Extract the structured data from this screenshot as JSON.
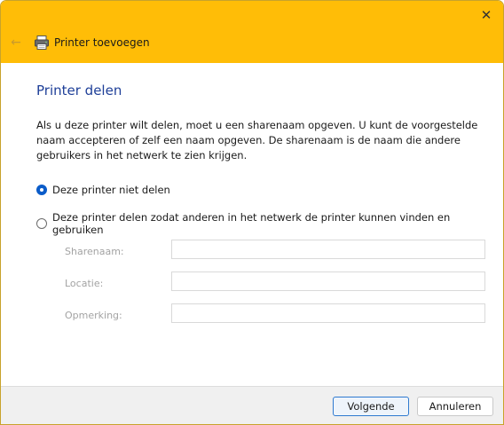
{
  "window": {
    "accent_color": "#ffbd07",
    "close_icon": "✕",
    "back_icon": "←"
  },
  "header": {
    "title": "Printer toevoegen"
  },
  "main": {
    "heading": "Printer delen",
    "description": "Als u deze printer wilt delen, moet u een sharenaam opgeven. U kunt de voorgestelde naam accepteren of zelf een naam opgeven. De sharenaam is de naam die andere gebruikers in het netwerk te zien krijgen.",
    "options": [
      {
        "label": "Deze printer niet delen",
        "selected": true
      },
      {
        "label": "Deze printer delen zodat anderen in het netwerk de printer kunnen vinden en gebruiken",
        "selected": false
      }
    ],
    "fields": [
      {
        "label": "Sharenaam:",
        "value": ""
      },
      {
        "label": "Locatie:",
        "value": ""
      },
      {
        "label": "Opmerking:",
        "value": ""
      }
    ]
  },
  "footer": {
    "next_label": "Volgende",
    "cancel_label": "Annuleren"
  }
}
